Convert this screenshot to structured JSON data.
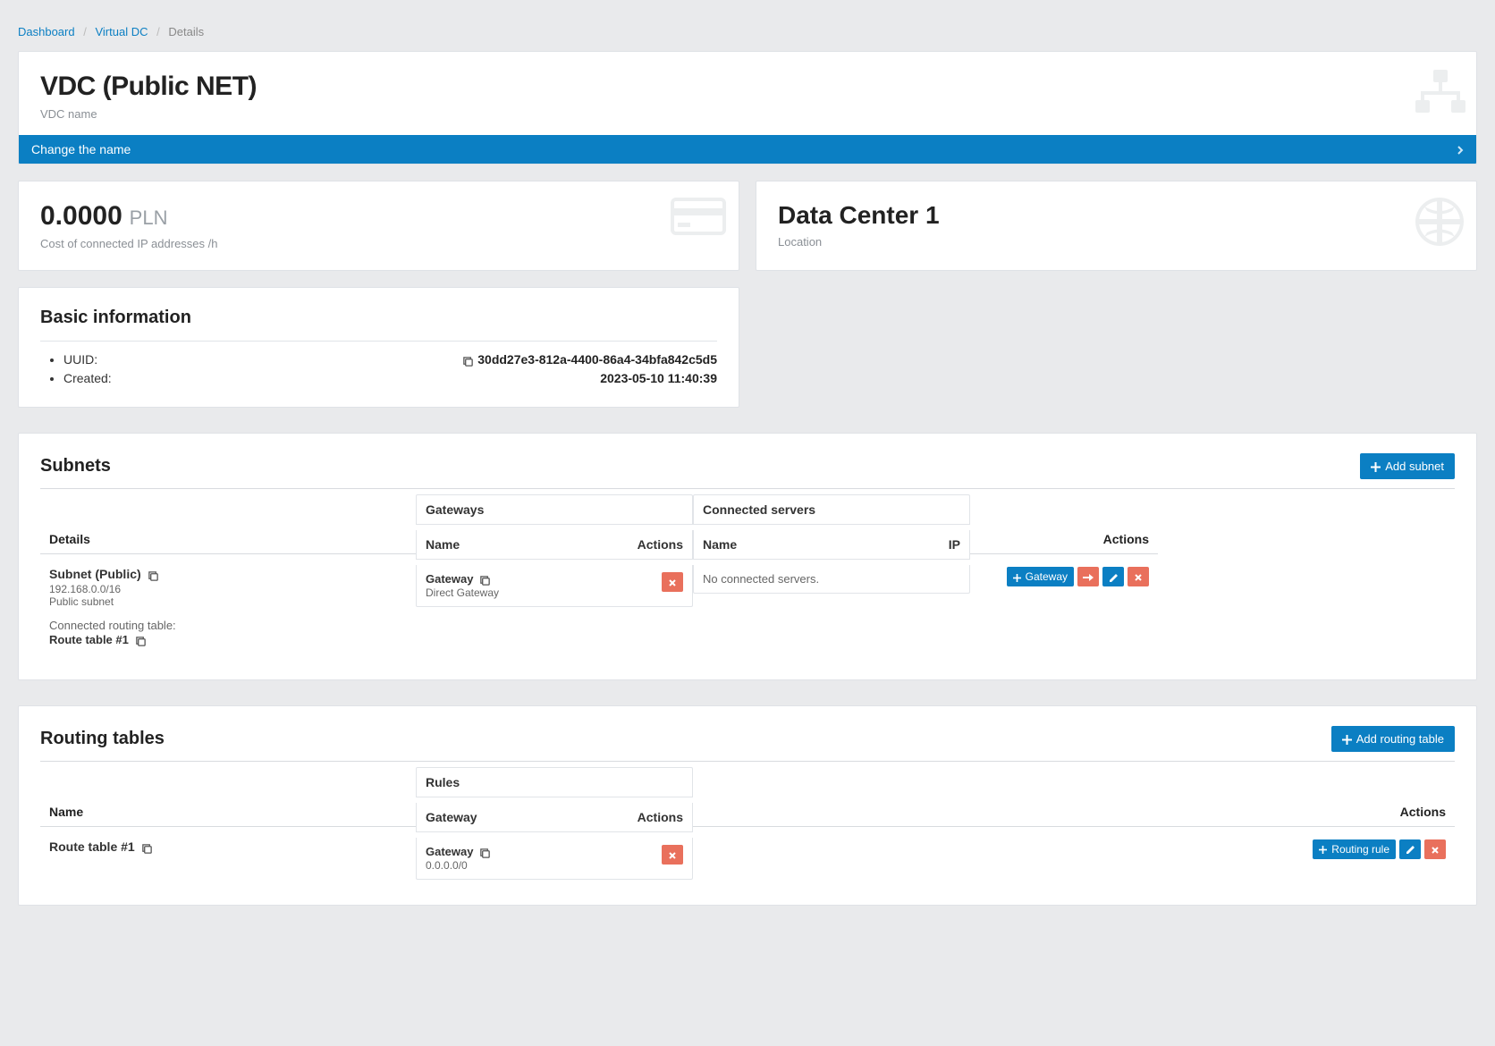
{
  "breadcrumb": {
    "dashboard": "Dashboard",
    "virtual_dc": "Virtual DC",
    "current": "Details"
  },
  "header": {
    "title": "VDC (Public NET)",
    "subtitle": "VDC name",
    "change_name": "Change the name"
  },
  "cost": {
    "value": "0.0000",
    "currency": "PLN",
    "label": "Cost of connected IP addresses /h"
  },
  "dc": {
    "name": "Data Center 1",
    "label": "Location"
  },
  "basic": {
    "title": "Basic information",
    "uuid_label": "UUID:",
    "uuid_value": "30dd27e3-812a-4400-86a4-34bfa842c5d5",
    "created_label": "Created:",
    "created_value": "2023-05-10 11:40:39"
  },
  "subnets": {
    "title": "Subnets",
    "add_btn": "Add subnet",
    "col_details": "Details",
    "gateways_title": "Gateways",
    "gateways_name": "Name",
    "gateways_actions": "Actions",
    "servers_title": "Connected servers",
    "servers_name": "Name",
    "servers_ip": "IP",
    "actions_col": "Actions",
    "row": {
      "name": "Subnet (Public)",
      "cidr": "192.168.0.0/16",
      "type": "Public subnet",
      "routing_label": "Connected routing table:",
      "routing_name": "Route table #1",
      "gateway_name": "Gateway",
      "gateway_type": "Direct Gateway",
      "no_servers": "No connected servers.",
      "btn_gateway": "Gateway"
    }
  },
  "routing": {
    "title": "Routing tables",
    "add_btn": "Add routing table",
    "col_name": "Name",
    "rules_title": "Rules",
    "rules_gateway": "Gateway",
    "rules_actions": "Actions",
    "actions_col": "Actions",
    "row": {
      "name": "Route table #1",
      "rule_gateway": "Gateway",
      "rule_cidr": "0.0.0.0/0",
      "btn_rule": "Routing rule"
    }
  }
}
